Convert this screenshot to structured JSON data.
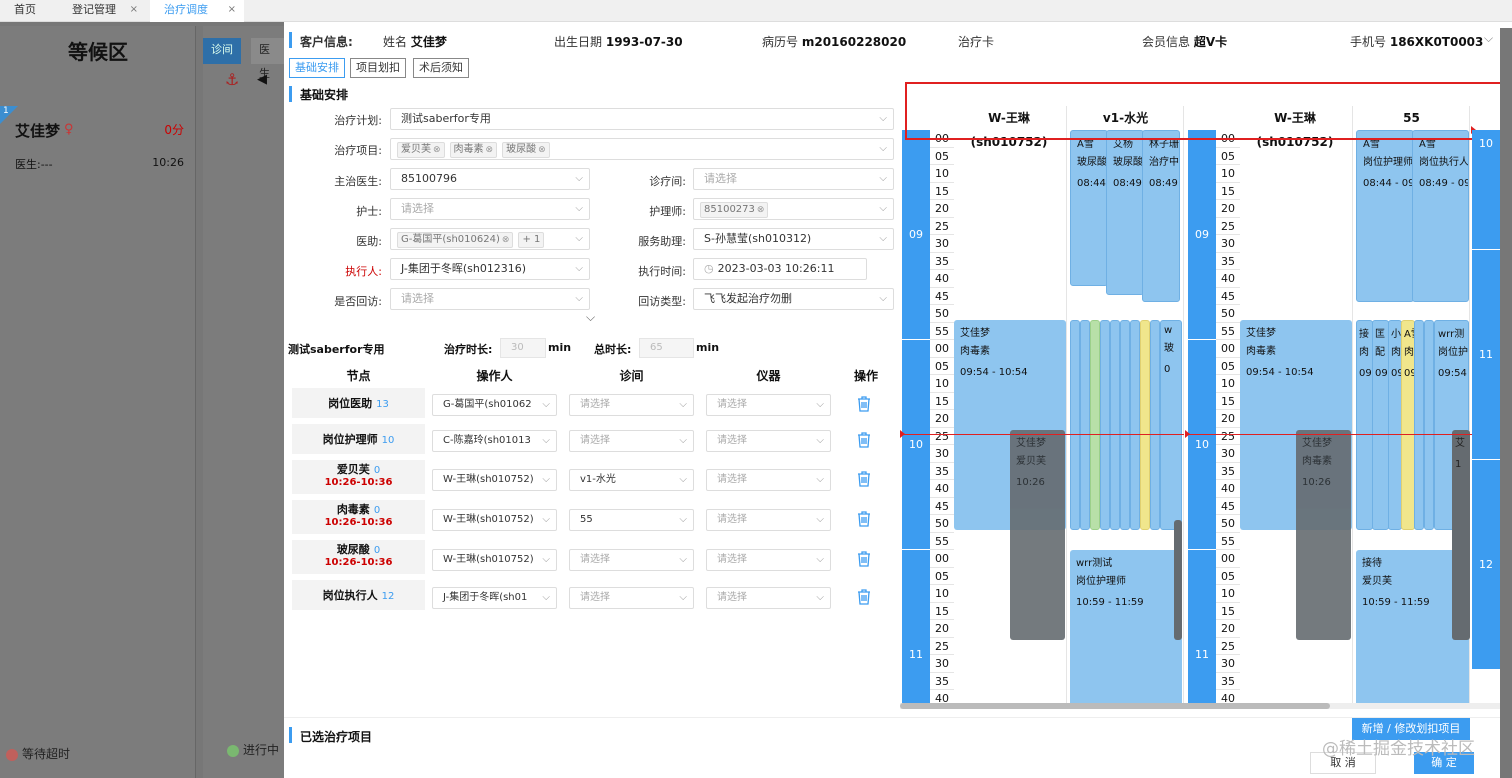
{
  "tabs": [
    {
      "label": "首页"
    },
    {
      "label": "登记管理"
    },
    {
      "label": "治疗调度"
    }
  ],
  "close_glyph": "×",
  "waiting": {
    "title": "等候区",
    "badge": "1",
    "patient_name": "艾佳梦",
    "gender_symbol": "♀",
    "wait_minutes": "0分",
    "doctor": "医生:---",
    "time": "10:26",
    "legend_timeout": "等待超时"
  },
  "pane2": {
    "tab1": "诊间",
    "tab2": "医生",
    "anchor": "⚓",
    "left_arrow": "◀",
    "in_progress": "进行中"
  },
  "customer": {
    "section_label": "客户信息:",
    "name_label": "姓名",
    "name": "艾佳梦",
    "birth_label": "出生日期",
    "birth": "1993-07-30",
    "record_label": "病历号",
    "record": "m20160228020",
    "card_label": "治疗卡",
    "member_label": "会员信息",
    "member": "超V卡",
    "phone_label": "手机号",
    "phone": "186XK0T0003",
    "collapse": "⌵"
  },
  "subtabs": [
    "基础安排",
    "项目划扣",
    "术后须知"
  ],
  "basic": {
    "section": "基础安排",
    "plan_label": "治疗计划:",
    "plan": "测试saberfor专用",
    "items_label": "治疗项目:",
    "items": [
      "爱贝芙",
      "肉毒素",
      "玻尿酸"
    ],
    "doctor_label": "主治医生:",
    "doctor": "85100796",
    "room_label": "诊疗间:",
    "room_ph": "请选择",
    "nurse_label": "护士:",
    "nurse_ph": "请选择",
    "caregiver_label": "护理师:",
    "caregiver": "85100273",
    "assistant_label": "医助:",
    "assistant": "G-葛国平(sh010624)",
    "assistant_more": "+ 1",
    "service_label": "服务助理:",
    "service": "S-孙慧莹(sh010312)",
    "executor_label": "执行人:",
    "executor": "J-集团于冬晖(sh012316)",
    "exec_time_label": "执行时间:",
    "exec_time": "2023-03-03 10:26:11",
    "revisit_label": "是否回访:",
    "revisit_ph": "请选择",
    "revisit_type_label": "回访类型:",
    "revisit_type": "飞飞发起治疗勿删",
    "expand": "⌵"
  },
  "plan": {
    "name": "测试saberfor专用",
    "duration_label": "治疗时长:",
    "duration": "30",
    "unit": "min",
    "total_label": "总时长:",
    "total": "65",
    "headers": {
      "node": "节点",
      "operator": "操作人",
      "room": "诊间",
      "device": "仪器",
      "action": "操作"
    },
    "select_ph": "请选择",
    "rows": [
      {
        "node": "岗位医助",
        "count": "13",
        "time": "",
        "operator": "G-葛国平(sh01062",
        "room": "",
        "device": ""
      },
      {
        "node": "岗位护理师",
        "count": "10",
        "time": "",
        "operator": "C-陈嘉玲(sh01013",
        "room": "",
        "device": ""
      },
      {
        "node": "爱贝芙",
        "count": "0",
        "time": "10:26-10:36",
        "operator": "W-王琳(sh010752)",
        "room": "v1-水光",
        "device": ""
      },
      {
        "node": "肉毒素",
        "count": "0",
        "time": "10:26-10:36",
        "operator": "W-王琳(sh010752)",
        "room": "55",
        "device": ""
      },
      {
        "node": "玻尿酸",
        "count": "0",
        "time": "10:26-10:36",
        "operator": "W-王琳(sh010752)",
        "room": "",
        "device": ""
      },
      {
        "node": "岗位执行人",
        "count": "12",
        "time": "",
        "operator": "J-集团于冬晖(sh01",
        "room": "",
        "device": ""
      }
    ]
  },
  "schedule": {
    "col_headers": [
      "W-王琳(sh010752)",
      "v1-水光",
      "W-王琳(sh010752)",
      "55"
    ],
    "hours": [
      "09",
      "10",
      "11"
    ],
    "right_hours": [
      "10",
      "11",
      "12"
    ],
    "minutes": [
      "00",
      "05",
      "10",
      "15",
      "20",
      "25",
      "30",
      "35",
      "40",
      "45",
      "50",
      "55"
    ],
    "appts": {
      "a_top1": [
        "A雪",
        "玻尿酸",
        "08:44"
      ],
      "a_top2": [
        "艾杨",
        "玻尿酸",
        "08:49"
      ],
      "a_top3": [
        "林子珊",
        "治疗中",
        "08:49"
      ],
      "b_main": [
        "艾佳梦",
        "肉毒素",
        "09:54 - 10:54"
      ],
      "b_grey": [
        "艾佳梦",
        "爱贝芙",
        "10:26"
      ],
      "c_main": [
        "wrr测试",
        "岗位护理师",
        "10:59 - 11:59"
      ],
      "c_side": [
        "w",
        "玻",
        "0"
      ],
      "d_top1": [
        "A雪",
        "岗位护理师",
        "08:44 - 09"
      ],
      "d_top2": [
        "A雪",
        "岗位执行人",
        "08:49 - 09"
      ],
      "e_main": [
        "艾佳梦",
        "肉毒素",
        "09:54 - 10:54"
      ],
      "e_grey": [
        "艾佳梦",
        "肉毒素",
        "10:26"
      ],
      "e_s1": [
        "接",
        "肉",
        "09"
      ],
      "e_s2": [
        "匡",
        "配",
        "09"
      ],
      "e_s3": [
        "小",
        "肉",
        "09"
      ],
      "e_s4": [
        "A雪",
        "肉",
        "09"
      ],
      "e_s5": [
        "wrr测",
        "岗位护",
        "09:54"
      ],
      "f_main": [
        "接待",
        "爱贝芙",
        "10:59 - 11:59"
      ],
      "f_side": [
        "艾",
        "",
        "1"
      ]
    }
  },
  "bottom": {
    "section": "已选治疗项目",
    "add_button": "新增 / 修改划扣项目",
    "cancel": "取 消",
    "confirm": "确 定",
    "watermark": "@稀土掘金技术社区"
  },
  "colors": {
    "accent": "#3c9cf0",
    "appt_blue": "#8ec5ef",
    "appt_green": "#b8e0a8",
    "appt_yellow": "#f0e68c",
    "grey": "#666666",
    "now_line": "#e02020"
  },
  "icons": {
    "trash": "trash-icon",
    "clock": "clock-icon",
    "chevron": "chevron-down-icon"
  }
}
